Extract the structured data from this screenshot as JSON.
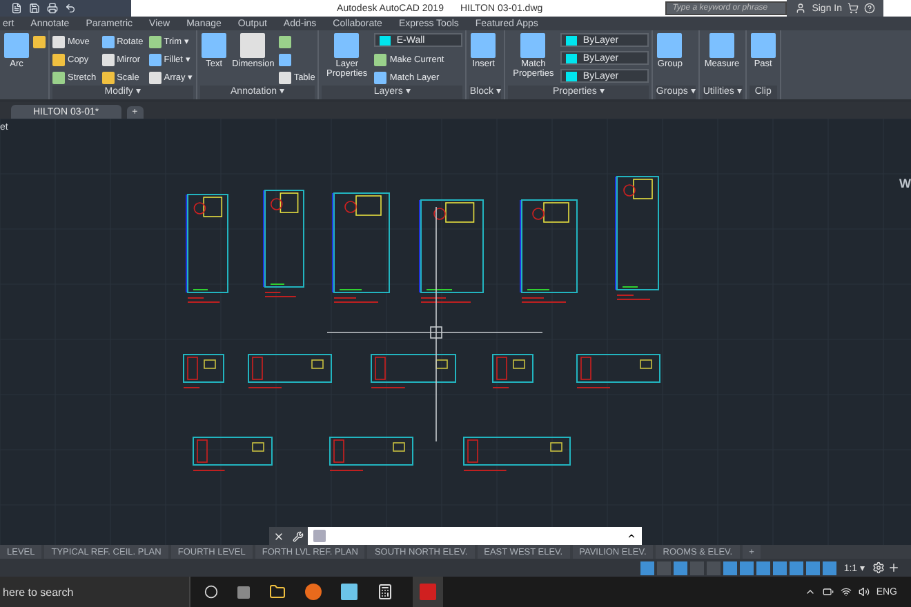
{
  "title": {
    "app": "Autodesk AutoCAD 2019",
    "file": "HILTON 03-01.dwg"
  },
  "search": {
    "placeholder": "Type a keyword or phrase"
  },
  "sign_in": "Sign In",
  "ribbon_tabs": [
    {
      "label": "ert",
      "selected": false
    },
    {
      "label": "Annotate",
      "selected": false
    },
    {
      "label": "Parametric",
      "selected": false
    },
    {
      "label": "View",
      "selected": false
    },
    {
      "label": "Manage",
      "selected": false
    },
    {
      "label": "Output",
      "selected": false
    },
    {
      "label": "Add-ins",
      "selected": false
    },
    {
      "label": "Collaborate",
      "selected": false
    },
    {
      "label": "Express Tools",
      "selected": false
    },
    {
      "label": "Featured Apps",
      "selected": false
    }
  ],
  "panels": [
    {
      "tools": [
        {
          "kind": "large",
          "label": "Arc"
        },
        {
          "kind": "small"
        }
      ]
    },
    {
      "title": "Modify ▾",
      "tools": [
        {
          "kind": "small",
          "label": "Move"
        },
        {
          "kind": "small",
          "label": "Copy"
        },
        {
          "kind": "small",
          "label": "Stretch"
        },
        {
          "kind": "small",
          "label": "Rotate"
        },
        {
          "kind": "small",
          "label": "Mirror"
        },
        {
          "kind": "small",
          "label": "Scale"
        },
        {
          "kind": "small",
          "label": "Trim ▾"
        },
        {
          "kind": "small",
          "label": "Fillet ▾"
        },
        {
          "kind": "small",
          "label": "Array ▾"
        }
      ]
    },
    {
      "title": "Annotation ▾",
      "tools": [
        {
          "kind": "large",
          "label": "Text"
        },
        {
          "kind": "large",
          "label": "Dimension"
        },
        {
          "kind": "small"
        },
        {
          "kind": "small"
        },
        {
          "kind": "small",
          "label": "Table"
        }
      ]
    },
    {
      "title": "Layers ▾",
      "tools": [
        {
          "kind": "large",
          "label": "Layer Properties"
        },
        {
          "kind": "dropdown",
          "label": "E-Wall"
        },
        {
          "kind": "small",
          "label": "Make Current"
        },
        {
          "kind": "small",
          "label": "Match Layer"
        }
      ]
    },
    {
      "title": "Block ▾",
      "tools": [
        {
          "kind": "large",
          "label": "Insert"
        }
      ]
    },
    {
      "title": "Properties ▾",
      "tools": [
        {
          "kind": "large",
          "label": "Match Properties"
        },
        {
          "kind": "dropdown",
          "label": "ByLayer"
        },
        {
          "kind": "dropdown",
          "label": "ByLayer"
        },
        {
          "kind": "dropdown",
          "label": "ByLayer"
        }
      ]
    },
    {
      "title": "Groups ▾",
      "tools": [
        {
          "kind": "large",
          "label": "Group"
        }
      ]
    },
    {
      "title": "Utilities ▾",
      "tools": [
        {
          "kind": "large",
          "label": "Measure"
        }
      ]
    },
    {
      "title": "Clip",
      "tools": [
        {
          "kind": "large",
          "label": "Past"
        }
      ]
    }
  ],
  "doc_tabs": [
    {
      "label": "HILTON 03-01*",
      "selected": true
    }
  ],
  "new_tab": "+",
  "viewport_label": "et",
  "viewcube_label": "W",
  "layout_tabs": [
    {
      "label": "LEVEL",
      "selected": false
    },
    {
      "label": "TYPICAL REF. CEIL. PLAN",
      "selected": false
    },
    {
      "label": "FOURTH LEVEL",
      "selected": false
    },
    {
      "label": "FORTH LVL REF. PLAN",
      "selected": false
    },
    {
      "label": "SOUTH NORTH ELEV.",
      "selected": false
    },
    {
      "label": "EAST WEST ELEV.",
      "selected": false
    },
    {
      "label": "PAVILION ELEV.",
      "selected": false
    },
    {
      "label": "ROOMS & ELEV.",
      "selected": false
    }
  ],
  "new_layout": "+",
  "status_bar": {
    "scale": "1:1 ▾",
    "toggles": [
      {
        "on": true
      },
      {
        "on": false
      },
      {
        "on": true
      },
      {
        "on": false
      },
      {
        "on": false
      },
      {
        "on": true
      },
      {
        "on": true
      },
      {
        "on": true
      },
      {
        "on": true
      },
      {
        "on": true
      },
      {
        "on": true
      },
      {
        "on": true
      }
    ]
  },
  "taskbar": {
    "search_placeholder": "here to search",
    "language": "ENG"
  }
}
